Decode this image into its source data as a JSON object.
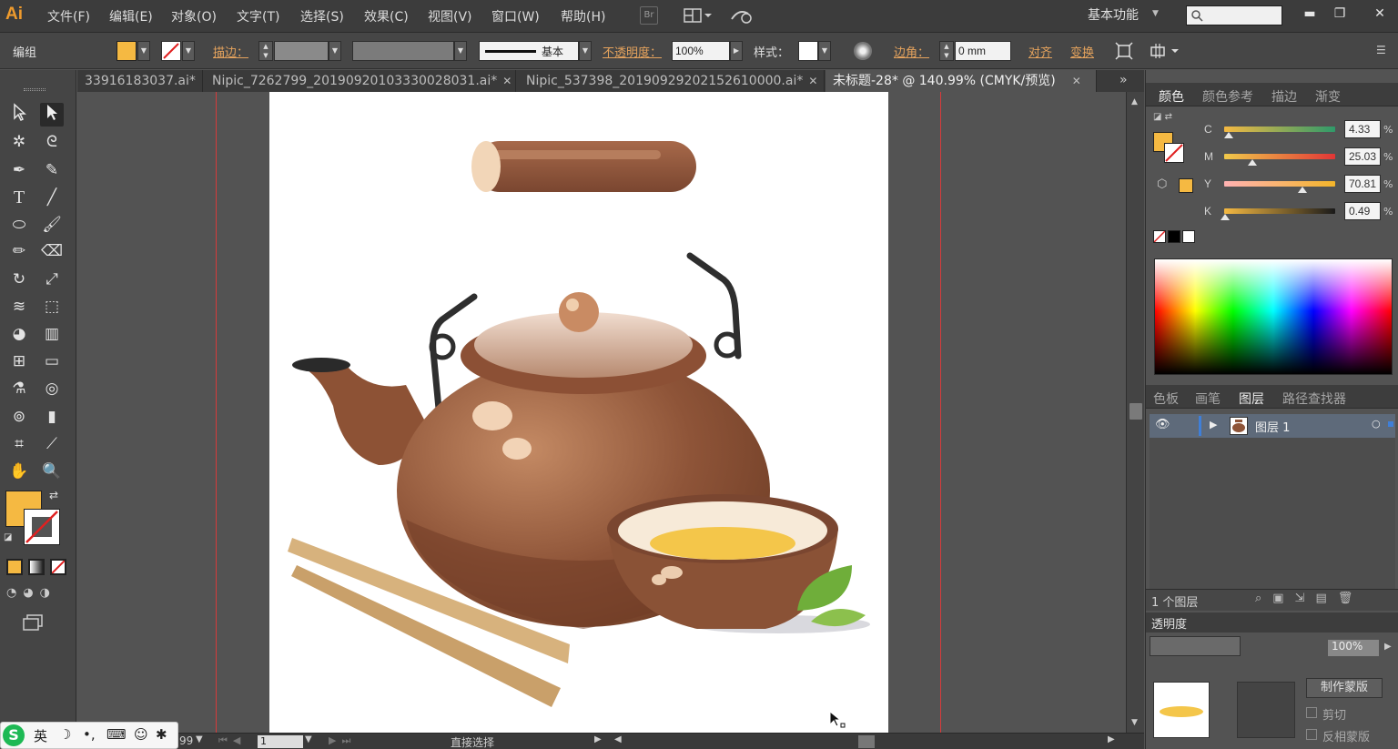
{
  "app": {
    "logo": "Ai"
  },
  "menu": {
    "items": [
      "文件(F)",
      "编辑(E)",
      "对象(O)",
      "文字(T)",
      "选择(S)",
      "效果(C)",
      "视图(V)",
      "窗口(W)",
      "帮助(H)"
    ],
    "bridge_icon": "Br",
    "workspace": "基本功能"
  },
  "control": {
    "mode": "编组",
    "fill_color": "#f5b942",
    "stroke_label": "描边：",
    "stroke_style": "基本",
    "opacity_label": "不透明度：",
    "opacity_value": "100%",
    "style_label": "样式：",
    "corner_label": "边角：",
    "corner_value": "0 mm",
    "align_label": "对齐",
    "transform_label": "变换"
  },
  "tabs": [
    {
      "label": "33916183037.ai*",
      "active": false
    },
    {
      "label": "Nipic_7262799_20190920103330028031.ai*",
      "active": false
    },
    {
      "label": "Nipic_537398_20190929202152610000.ai*",
      "active": false
    },
    {
      "label": "未标题-28* @ 140.99% (CMYK/预览)",
      "active": true
    }
  ],
  "tools": {
    "fill_color": "#f5b942"
  },
  "status": {
    "zoom_fragment": "99",
    "page_value": "1",
    "tool_name": "直接选择"
  },
  "color_panel": {
    "tabs": [
      "颜色",
      "颜色参考",
      "描边",
      "渐变"
    ],
    "active_tab": "颜色",
    "swatch_color": "#f5b942",
    "channels": [
      {
        "label": "C",
        "value": "4.33",
        "fraction": 0.043
      },
      {
        "label": "M",
        "value": "25.03",
        "fraction": 0.25
      },
      {
        "label": "Y",
        "value": "70.81",
        "fraction": 0.708
      },
      {
        "label": "K",
        "value": "0.49",
        "fraction": 0.005
      }
    ],
    "percent_sign": "%"
  },
  "layers_panel": {
    "tabs": [
      "色板",
      "画笔",
      "图层",
      "路径查找器"
    ],
    "active_tab": "图层",
    "layer_name": "图层 1",
    "layer_count": "1 个图层"
  },
  "transparency_panel": {
    "title": "透明度",
    "opacity": "100%",
    "make_mask": "制作蒙版",
    "clip": "剪切",
    "invert_mask": "反相蒙版"
  },
  "ime": {
    "lang": "英"
  }
}
